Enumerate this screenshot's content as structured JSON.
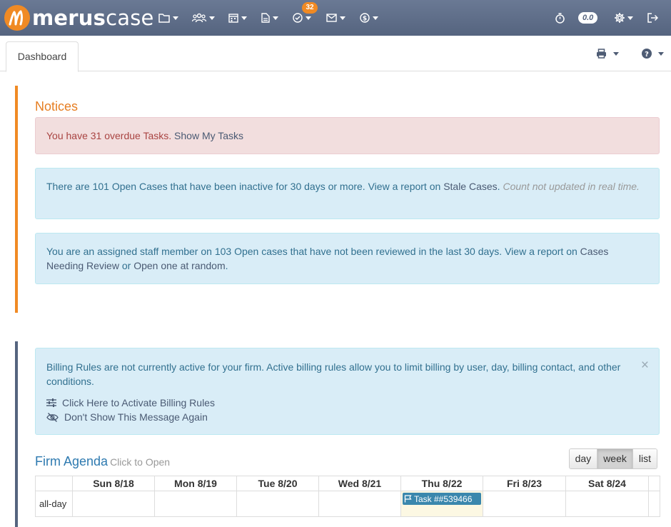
{
  "brand": {
    "name_bold": "merus",
    "name_thin": "case",
    "accent_color": "#f08a24",
    "nav_color": "#55647f"
  },
  "topnav": {
    "icons": [
      "folder-icon",
      "people-icon",
      "calendar-icon",
      "document-icon",
      "task-check-icon",
      "mail-icon",
      "billing-dollar-icon"
    ],
    "tasks_badge": "32",
    "timer_value": "0.0",
    "right_icons": [
      "stopwatch-icon",
      "gear-icon",
      "logout-icon"
    ]
  },
  "tabs": {
    "dashboard": "Dashboard"
  },
  "notices": {
    "title": "Notices",
    "overdue": {
      "text": "You have 31 overdue Tasks.",
      "link": "Show My Tasks"
    },
    "stale": {
      "text": "There are 101 Open Cases that have been inactive for 30 days or more. View a report on",
      "link": "Stale Cases",
      "after": ".",
      "note": "Count not updated in real time."
    },
    "review": {
      "text": "You are an assigned staff member on 103 Open cases that have not been reviewed in the last 30 days. View a report on",
      "link1": "Cases Needing Review",
      "or": "or",
      "link2": "Open one at random",
      "after": "."
    }
  },
  "billing": {
    "message": "Billing Rules are not currently active for your firm. Active billing rules allow you to limit billing by user, day, billing contact, and other conditions.",
    "close": "×",
    "activate": "Click Here to Activate Billing Rules",
    "dismiss": "Don't Show This Message Again"
  },
  "agenda": {
    "title": "Firm Agenda",
    "subtitle": "Click to Open",
    "views": [
      "day",
      "week",
      "list"
    ],
    "active_view": "week",
    "days": [
      "Sun 8/18",
      "Mon 8/19",
      "Tue 8/20",
      "Wed 8/21",
      "Thu 8/22",
      "Fri 8/23",
      "Sat 8/24"
    ],
    "allday_label": "all-day",
    "event": {
      "day": "Thu 8/22",
      "label": "Task ##539466"
    }
  }
}
